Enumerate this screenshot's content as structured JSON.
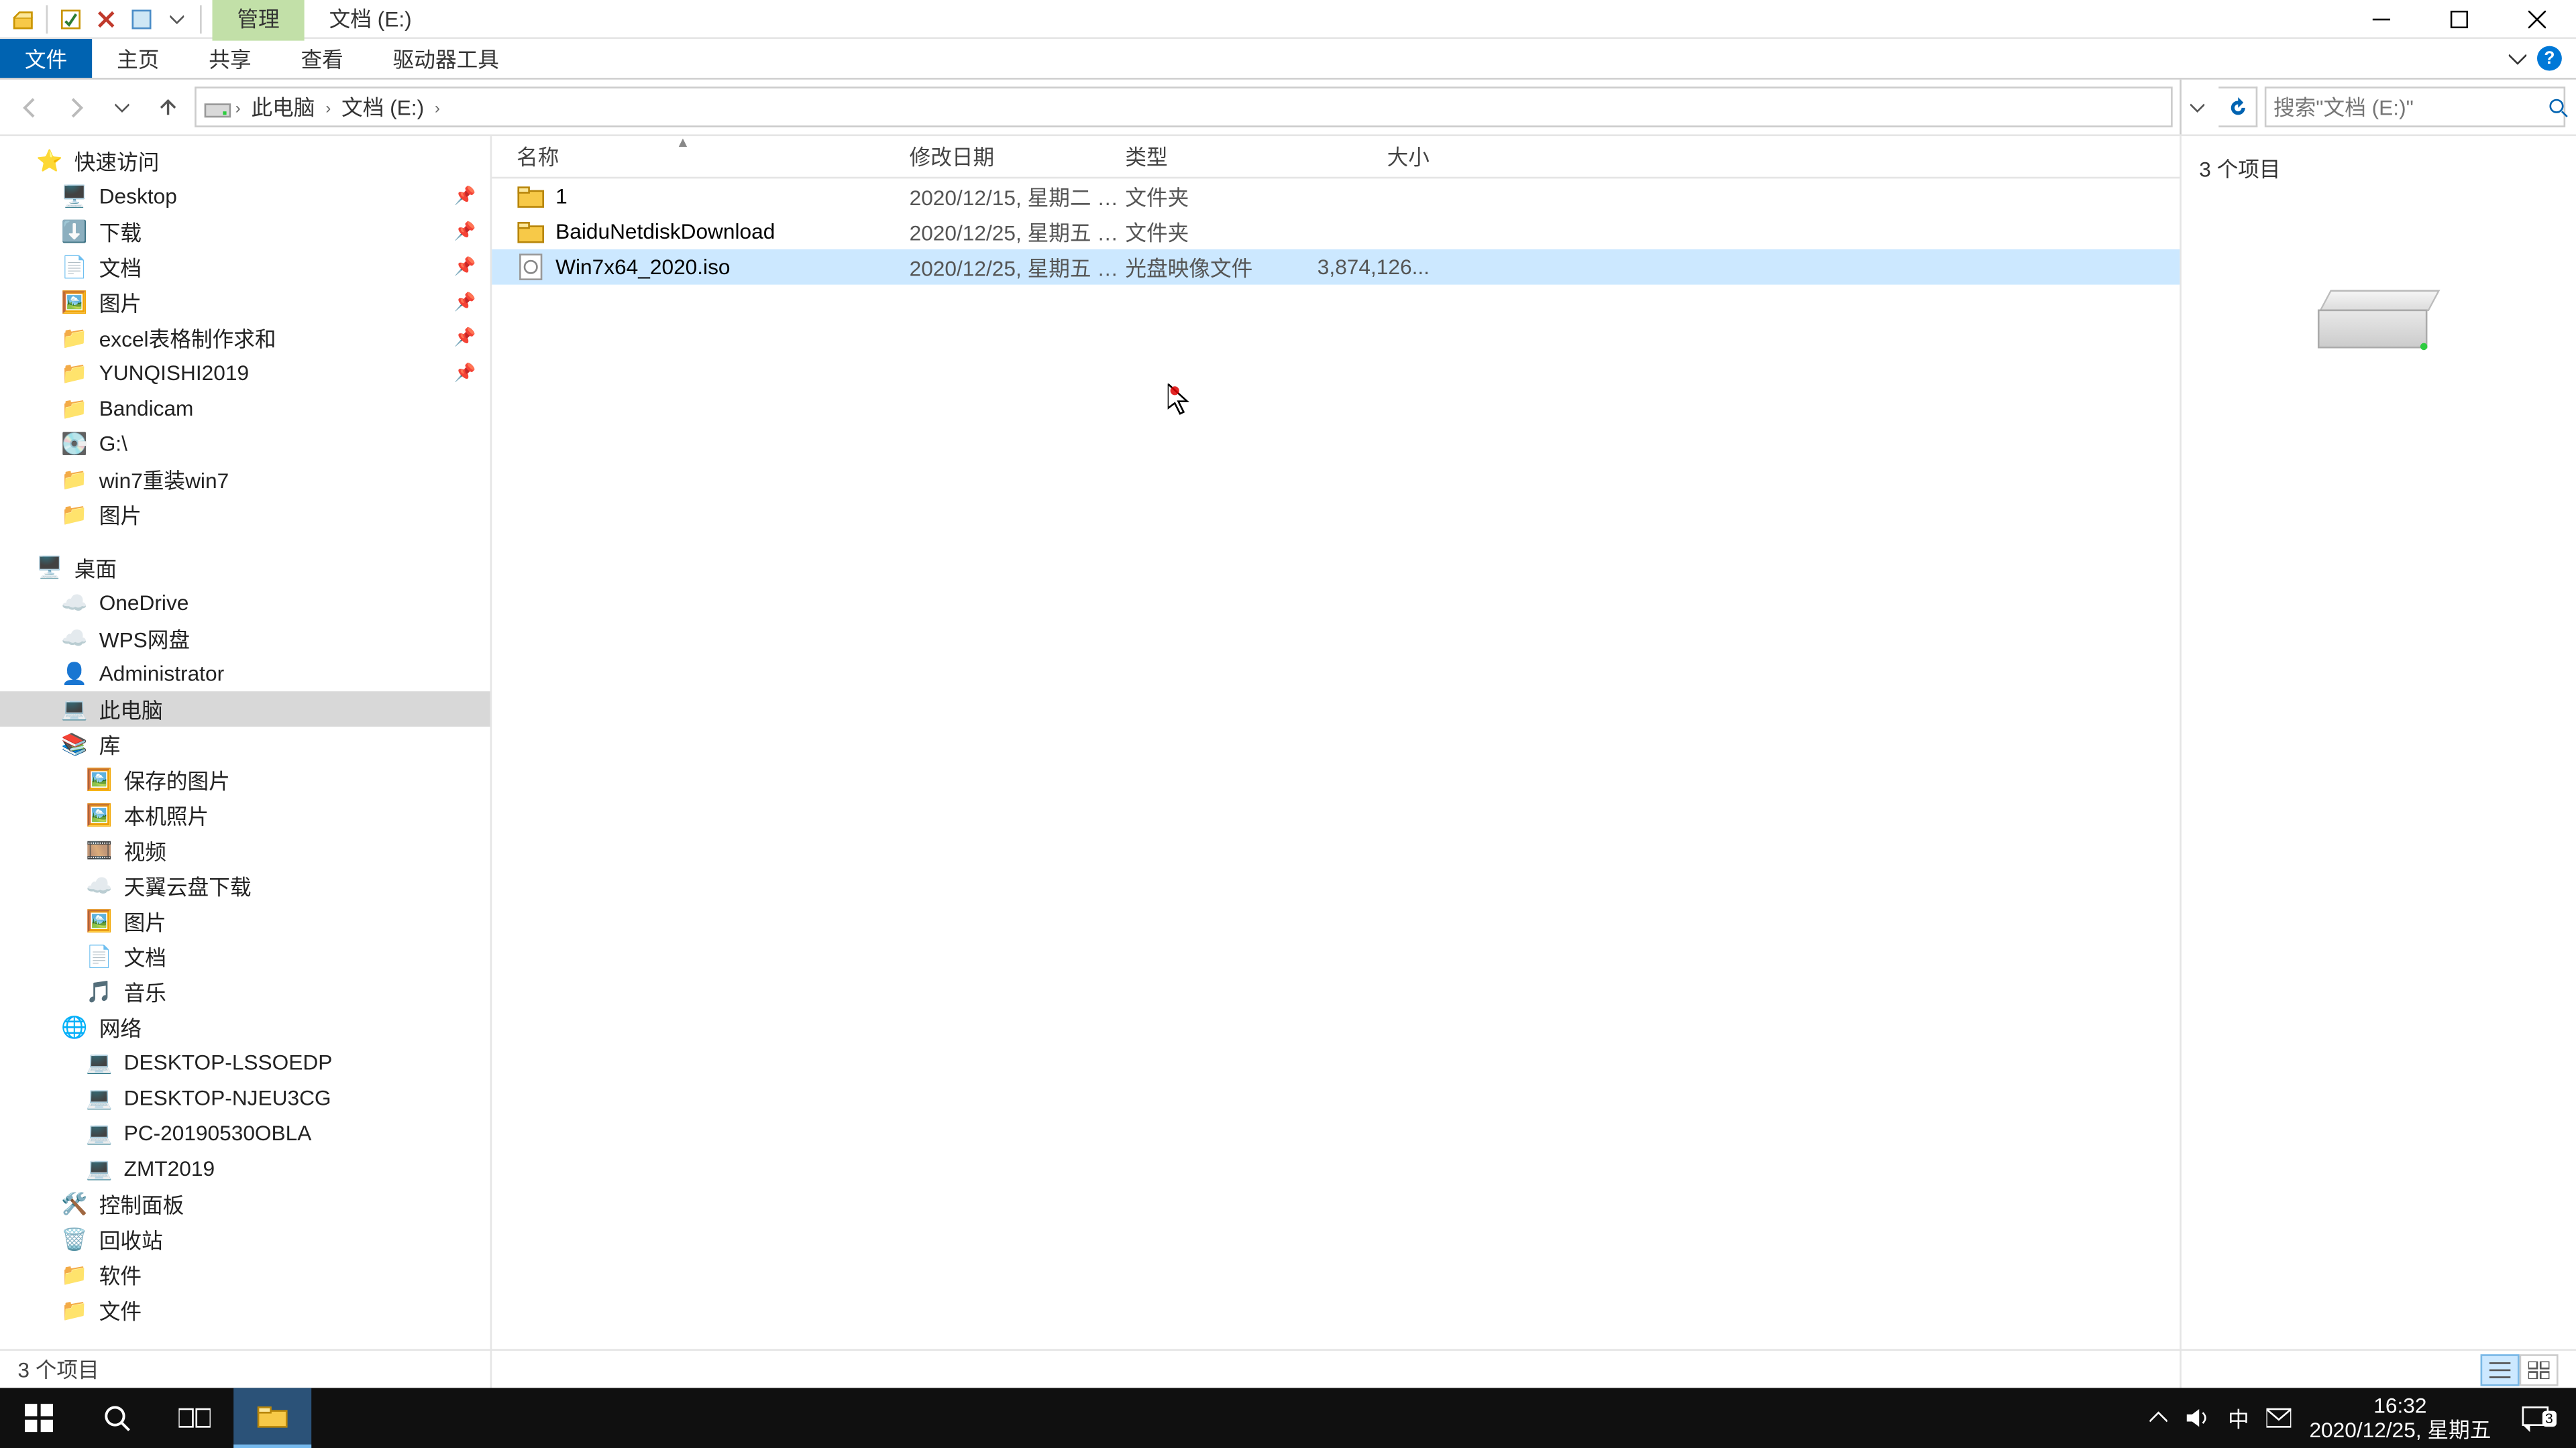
{
  "title": {
    "contextual_tab": "管理",
    "location_tab": "文档 (E:)"
  },
  "ribbon": {
    "file": "文件",
    "home": "主页",
    "share": "共享",
    "view": "查看",
    "drivetools": "驱动器工具"
  },
  "breadcrumb": {
    "root": "此电脑",
    "current": "文档 (E:)"
  },
  "search": {
    "placeholder": "搜索\"文档 (E:)\""
  },
  "tree": {
    "quick_access": "快速访问",
    "desktop": "Desktop",
    "downloads": "下载",
    "documents": "文档",
    "pictures": "图片",
    "excel": "excel表格制作求和",
    "yunqishi": "YUNQISHI2019",
    "bandicam": "Bandicam",
    "g_drive": "G:\\",
    "win7reinstall": "win7重装win7",
    "pictures2": "图片",
    "desktop_cn": "桌面",
    "onedrive": "OneDrive",
    "wps": "WPS网盘",
    "admin": "Administrator",
    "this_pc": "此电脑",
    "libraries": "库",
    "saved_pics": "保存的图片",
    "camera_roll": "本机照片",
    "videos": "视频",
    "tianyi": "天翼云盘下载",
    "pics3": "图片",
    "docs2": "文档",
    "music": "音乐",
    "network": "网络",
    "pc1": "DESKTOP-LSSOEDP",
    "pc2": "DESKTOP-NJEU3CG",
    "pc3": "PC-20190530OBLA",
    "pc4": "ZMT2019",
    "control_panel": "控制面板",
    "recycle": "回收站",
    "software": "软件",
    "files": "文件"
  },
  "columns": {
    "name": "名称",
    "date": "修改日期",
    "type": "类型",
    "size": "大小"
  },
  "rows": [
    {
      "name": "1",
      "date": "2020/12/15, 星期二 1...",
      "type": "文件夹",
      "size": "",
      "icon": "folder",
      "selected": false
    },
    {
      "name": "BaiduNetdiskDownload",
      "date": "2020/12/25, 星期五 1...",
      "type": "文件夹",
      "size": "",
      "icon": "folder",
      "selected": false
    },
    {
      "name": "Win7x64_2020.iso",
      "date": "2020/12/25, 星期五 1...",
      "type": "光盘映像文件",
      "size": "3,874,126...",
      "icon": "iso",
      "selected": true
    }
  ],
  "preview": {
    "count_label": "3 个项目"
  },
  "status": {
    "text": "3 个项目"
  },
  "tray": {
    "ime": "中",
    "time": "16:32",
    "date": "2020/12/25, 星期五",
    "notif_count": "3"
  }
}
